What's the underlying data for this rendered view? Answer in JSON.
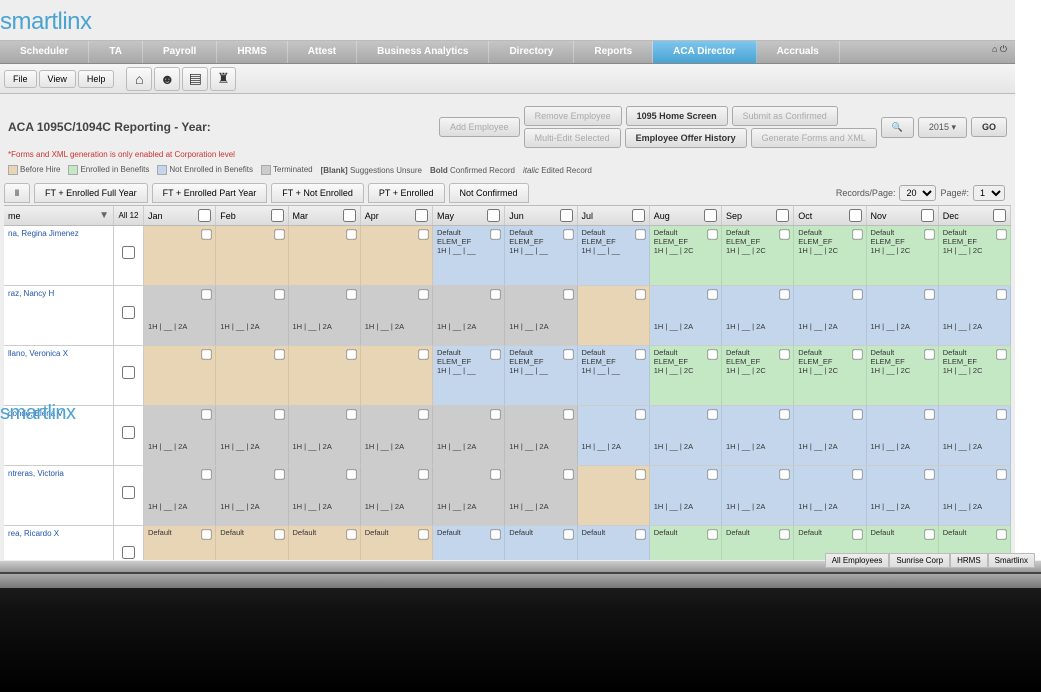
{
  "brand": "smartlinx",
  "nav": {
    "items": [
      "Scheduler",
      "TA",
      "Payroll",
      "HRMS",
      "Attest",
      "Business Analytics",
      "Directory",
      "Reports",
      "ACA Director",
      "Accruals"
    ],
    "active_index": 8
  },
  "menu": {
    "file": "File",
    "view": "View",
    "help": "Help"
  },
  "page": {
    "title": "ACA 1095C/1094C Reporting  - Year:",
    "subnote": "*Forms and XML generation is only enabled at Corporation level",
    "year": "2015",
    "go": "GO"
  },
  "action_buttons": {
    "add_employee": "Add Employee",
    "remove_employee": "Remove Employee",
    "home_screen": "1095 Home Screen",
    "submit_confirmed": "Submit as Confirmed",
    "multi_edit": "Multi-Edit Selected",
    "offer_history": "Employee Offer History",
    "generate": "Generate Forms and XML"
  },
  "legend": {
    "before_hire": "Before Hire",
    "enrolled": "Enrolled in Benefits",
    "not_enrolled": "Not Enrolled in Benefits",
    "terminated": "Terminated",
    "blank": "[Blank]",
    "suggestions": "Suggestions Unsure",
    "bold_lbl": "Bold",
    "bold_txt": "Confirmed Record",
    "italic_lbl": "italic",
    "italic_txt": "Edited Record"
  },
  "filter_tabs": [
    "ll",
    "FT + Enrolled Full Year",
    "FT + Enrolled Part Year",
    "FT + Not Enrolled",
    "PT + Enrolled",
    "Not Confirmed"
  ],
  "paging": {
    "records_label": "Records/Page:",
    "records_value": "20",
    "page_label": "Page#:",
    "page_value": "1"
  },
  "columns": {
    "name": "me",
    "all": "All 12",
    "months": [
      "Jan",
      "Feb",
      "Mar",
      "Apr",
      "May",
      "Jun",
      "Jul",
      "Aug",
      "Sep",
      "Oct",
      "Nov",
      "Dec"
    ]
  },
  "cell_text": {
    "default": "Default",
    "code_ef": "ELEM_EF",
    "vals_std": "1H | __ | __",
    "vals_2c": "1H | __ | 2C",
    "vals_2a": "1H | __ | 2A"
  },
  "employees": [
    {
      "name": "na, Regina Jimenez",
      "cells": [
        {
          "c": "c-tan"
        },
        {
          "c": "c-tan"
        },
        {
          "c": "c-tan"
        },
        {
          "c": "c-tan"
        },
        {
          "c": "c-blue",
          "t": "def_ef_std"
        },
        {
          "c": "c-blue",
          "t": "def_ef_std"
        },
        {
          "c": "c-blue",
          "t": "def_ef_std"
        },
        {
          "c": "c-green",
          "t": "def_ef_2c"
        },
        {
          "c": "c-green",
          "t": "def_ef_2c"
        },
        {
          "c": "c-green",
          "t": "def_ef_2c"
        },
        {
          "c": "c-green",
          "t": "def_ef_2c"
        },
        {
          "c": "c-green",
          "t": "def_ef_2c"
        }
      ]
    },
    {
      "name": "raz, Nancy H",
      "cells": [
        {
          "c": "c-gray",
          "t": "2a"
        },
        {
          "c": "c-gray",
          "t": "2a"
        },
        {
          "c": "c-gray",
          "t": "2a"
        },
        {
          "c": "c-gray",
          "t": "2a"
        },
        {
          "c": "c-gray",
          "t": "2a"
        },
        {
          "c": "c-gray",
          "t": "2a"
        },
        {
          "c": "c-tan"
        },
        {
          "c": "c-blue",
          "t": "2a"
        },
        {
          "c": "c-blue",
          "t": "2a"
        },
        {
          "c": "c-blue",
          "t": "2a"
        },
        {
          "c": "c-blue",
          "t": "2a"
        },
        {
          "c": "c-blue",
          "t": "2a"
        }
      ]
    },
    {
      "name": "llano, Veronica X",
      "cells": [
        {
          "c": "c-tan"
        },
        {
          "c": "c-tan"
        },
        {
          "c": "c-tan"
        },
        {
          "c": "c-tan"
        },
        {
          "c": "c-blue",
          "t": "def_ef_std"
        },
        {
          "c": "c-blue",
          "t": "def_ef_std"
        },
        {
          "c": "c-blue",
          "t": "def_ef_std"
        },
        {
          "c": "c-green",
          "t": "def_ef_2c"
        },
        {
          "c": "c-green",
          "t": "def_ef_2c"
        },
        {
          "c": "c-green",
          "t": "def_ef_2c"
        },
        {
          "c": "c-green",
          "t": "def_ef_2c"
        },
        {
          "c": "c-green",
          "t": "def_ef_2c"
        }
      ]
    },
    {
      "name": "dondo, Elena V",
      "cells": [
        {
          "c": "c-gray",
          "t": "2a"
        },
        {
          "c": "c-gray",
          "t": "2a"
        },
        {
          "c": "c-gray",
          "t": "2a"
        },
        {
          "c": "c-gray",
          "t": "2a"
        },
        {
          "c": "c-gray",
          "t": "2a"
        },
        {
          "c": "c-gray",
          "t": "2a"
        },
        {
          "c": "c-blue",
          "t": "2a"
        },
        {
          "c": "c-blue",
          "t": "2a"
        },
        {
          "c": "c-blue",
          "t": "2a"
        },
        {
          "c": "c-blue",
          "t": "2a"
        },
        {
          "c": "c-blue",
          "t": "2a"
        },
        {
          "c": "c-blue",
          "t": "2a"
        }
      ]
    },
    {
      "name": "ntreras, Victoria",
      "cells": [
        {
          "c": "c-gray",
          "t": "2a"
        },
        {
          "c": "c-gray",
          "t": "2a"
        },
        {
          "c": "c-gray",
          "t": "2a"
        },
        {
          "c": "c-gray",
          "t": "2a"
        },
        {
          "c": "c-gray",
          "t": "2a"
        },
        {
          "c": "c-gray",
          "t": "2a"
        },
        {
          "c": "c-tan"
        },
        {
          "c": "c-blue",
          "t": "2a"
        },
        {
          "c": "c-blue",
          "t": "2a"
        },
        {
          "c": "c-blue",
          "t": "2a"
        },
        {
          "c": "c-blue",
          "t": "2a"
        },
        {
          "c": "c-blue",
          "t": "2a"
        }
      ]
    },
    {
      "name": "rea, Ricardo X",
      "cells": [
        {
          "c": "c-tan",
          "t": "def"
        },
        {
          "c": "c-tan",
          "t": "def"
        },
        {
          "c": "c-tan",
          "t": "def"
        },
        {
          "c": "c-tan",
          "t": "def"
        },
        {
          "c": "c-blue",
          "t": "def"
        },
        {
          "c": "c-blue",
          "t": "def"
        },
        {
          "c": "c-blue",
          "t": "def"
        },
        {
          "c": "c-green",
          "t": "def"
        },
        {
          "c": "c-green",
          "t": "def"
        },
        {
          "c": "c-green",
          "t": "def"
        },
        {
          "c": "c-green",
          "t": "def"
        },
        {
          "c": "c-green",
          "t": "def"
        }
      ]
    }
  ],
  "status_tabs": [
    "All Employees",
    "Sunrise Corp",
    "HRMS",
    "Smartlinx"
  ]
}
